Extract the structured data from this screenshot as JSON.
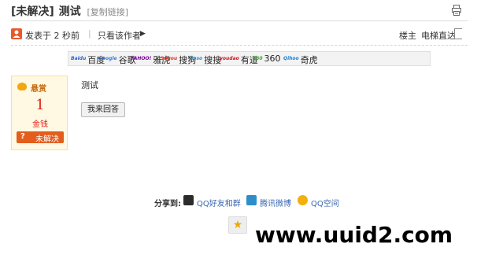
{
  "title_bar": {
    "status": "[未解决]",
    "title": "测试",
    "copy_link": "[复制链接]",
    "print_icon": "printer-icon"
  },
  "author_bar": {
    "posted_text": "发表于 2 秒前",
    "separator": "|",
    "only_author_text": "只看该作者",
    "floor_label": "楼主",
    "elevator_label": "电梯直达"
  },
  "search_engines": [
    {
      "logo": "Baidu",
      "label": "百度",
      "color": "#2a5fcf"
    },
    {
      "logo": "Google",
      "label": "谷歌",
      "color": "#3a7bd5"
    },
    {
      "logo": "YAHOO!",
      "label": "雅虎",
      "color": "#7b0099"
    },
    {
      "logo": "Sogou",
      "label": "搜狗",
      "color": "#e8301c"
    },
    {
      "logo": "Soso",
      "label": "搜搜",
      "color": "#1d8fd8"
    },
    {
      "logo": "youdao",
      "label": "有道",
      "color": "#d0101b"
    },
    {
      "logo": "360",
      "label": "360",
      "color": "#3aa02d"
    },
    {
      "logo": "Qihoo",
      "label": "奇虎",
      "color": "#1a7fcf"
    }
  ],
  "bounty": {
    "title": "悬赏",
    "amount": "1",
    "unit": "金钱",
    "status_question": "?",
    "status_label": "未解决"
  },
  "post": {
    "content": "测试",
    "answer_button": "我来回答"
  },
  "share": {
    "label": "分享到:",
    "items": [
      {
        "label": "QQ好友和群",
        "icon": "qq-icon",
        "color": "#2b2b2b"
      },
      {
        "label": "腾讯微博",
        "icon": "tencent-weibo-icon",
        "color": "#2d8ec9"
      },
      {
        "label": "QQ空间",
        "icon": "qzone-icon",
        "color": "#f2b00f"
      }
    ]
  },
  "favorite_icon": "star-icon",
  "watermark": "www.uuid2.com",
  "colors": {
    "accent_orange": "#e35d1c",
    "bounty_red": "#e3221b",
    "link_blue": "#3a67b0"
  }
}
